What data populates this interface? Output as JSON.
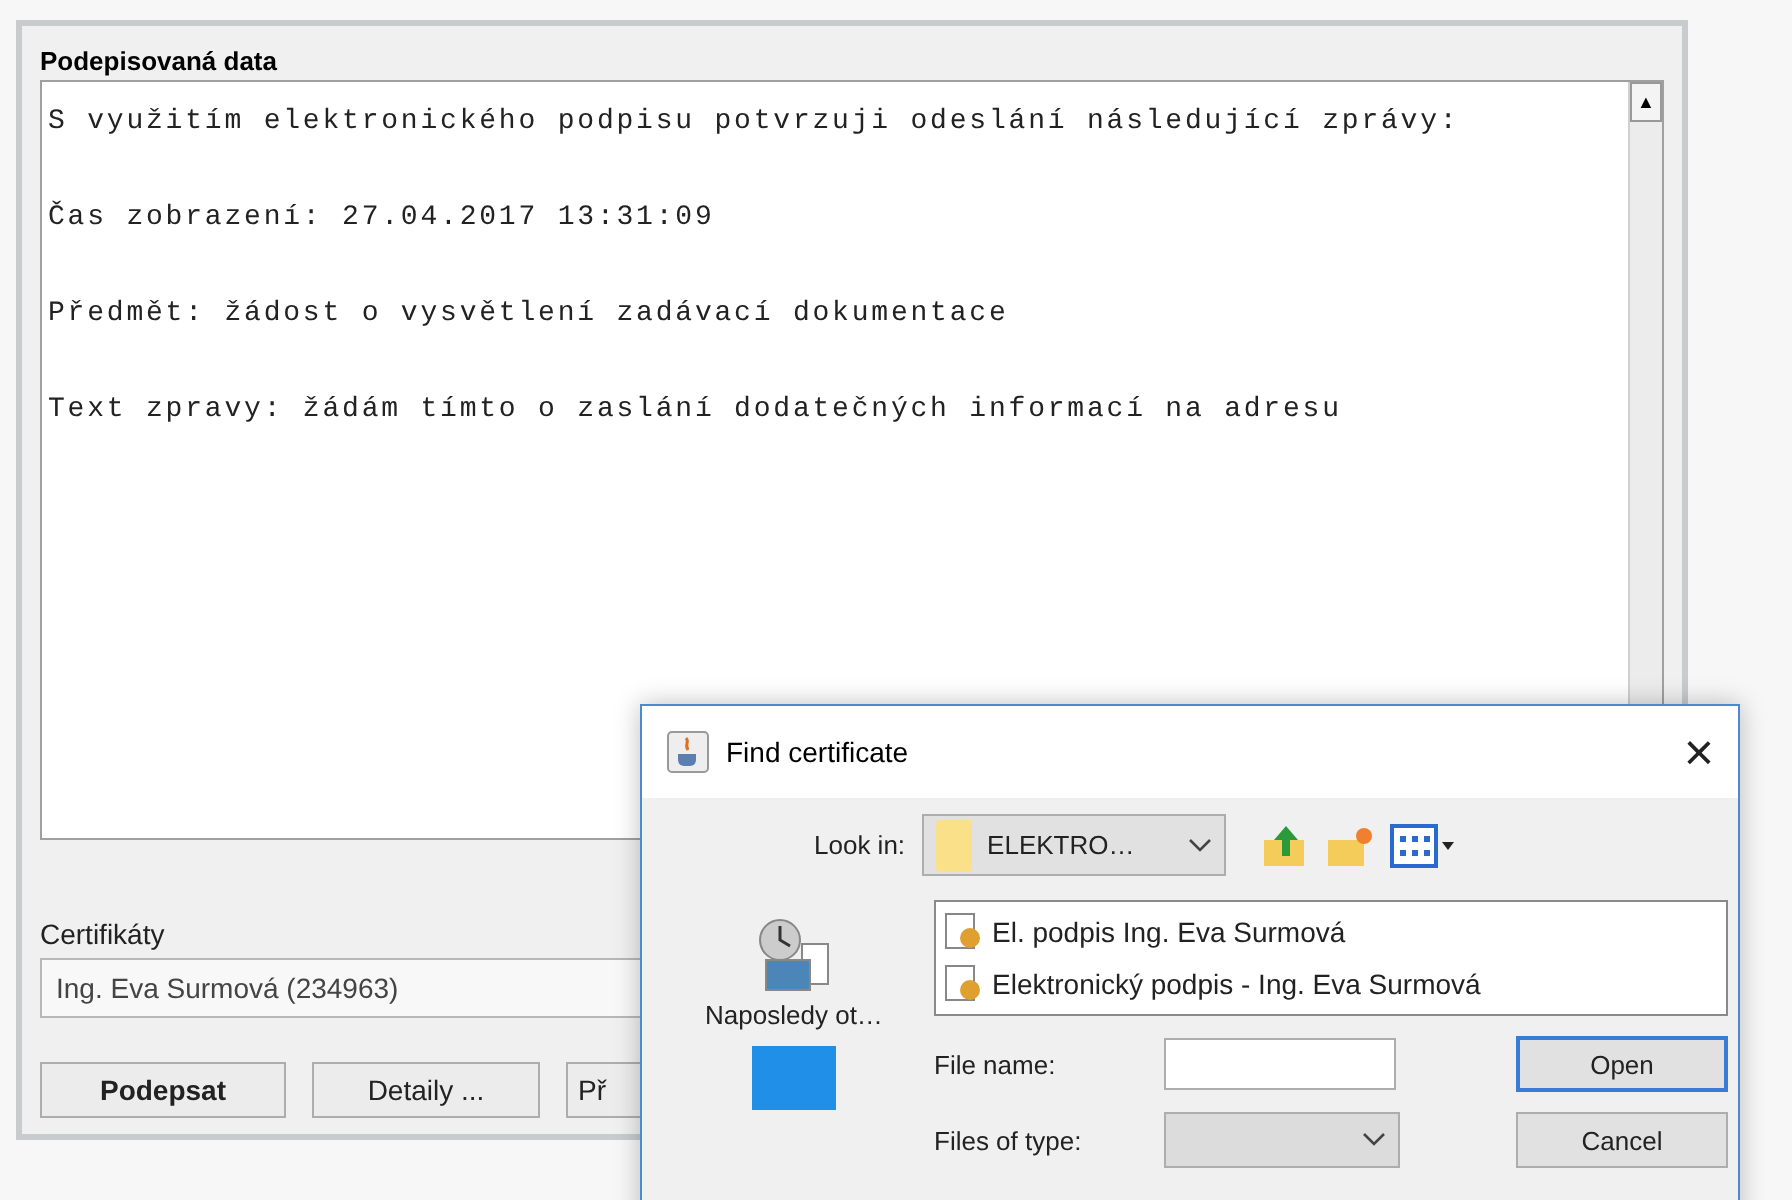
{
  "main": {
    "section_title": "Podepisovaná data",
    "paragraphs": [
      "S využitím elektronického podpisu potvrzuji odeslání následující zprávy:",
      "Čas zobrazení: 27.04.2017 13:31:09",
      "Předmět: žádost o vysvětlení zadávací dokumentace",
      "Text zpravy: žádám tímto o zaslání dodatečných informací na adresu"
    ],
    "scroll_up": "▲",
    "certificates_label": "Certifikáty",
    "certificate_value": "Ing. Eva Surmová (234963)",
    "buttons": [
      {
        "label": "Podepsat",
        "default": true
      },
      {
        "label": "Detaily ...",
        "default": false
      },
      {
        "label": "Př",
        "default": false
      }
    ]
  },
  "dialog": {
    "title": "Find certificate",
    "close": "×",
    "look_in_label": "Look in:",
    "look_in_value": "ELEKTRO…",
    "places": [
      {
        "kind": "recent",
        "label": "Naposledy ot…"
      },
      {
        "kind": "desktop"
      }
    ],
    "files": [
      "El. podpis Ing. Eva Surmová",
      "Elektronický podpis - Ing. Eva Surmová"
    ],
    "file_name_label": "File name:",
    "files_of_type_label": "Files of type:",
    "buttons": [
      {
        "label": "Open",
        "default": true
      },
      {
        "label": "Cancel",
        "default": false
      }
    ]
  }
}
